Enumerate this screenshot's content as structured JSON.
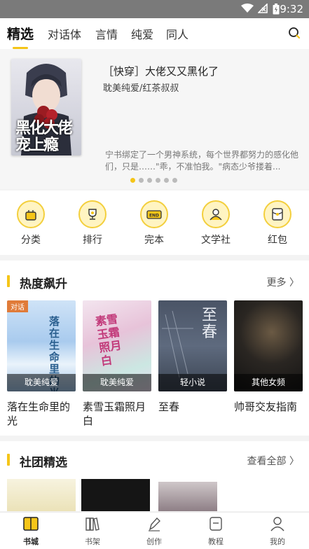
{
  "status": {
    "time": "9:32"
  },
  "tabs": [
    "精选",
    "对话体",
    "言情",
    "纯爱",
    "同人"
  ],
  "banner": {
    "title": "［快穿］大佬又又黑化了",
    "subtitle": "耽美纯爱/红茶叔叔",
    "description": "宁书绑定了一个男神系统，每个世界都努力的感化他们，只是……\"乖，不准怕我。\"病态少爷搂着...",
    "cover_text": "黑化大佬宠上瘾",
    "slide_count": 6,
    "active_slide": 0
  },
  "categories": [
    {
      "label": "分类",
      "icon": "shopping-bag-icon"
    },
    {
      "label": "排行",
      "icon": "trophy-icon"
    },
    {
      "label": "完本",
      "icon": "end-tag-icon"
    },
    {
      "label": "文学社",
      "icon": "people-icon"
    },
    {
      "label": "红包",
      "icon": "red-envelope-icon"
    }
  ],
  "hot_section": {
    "title": "热度飙升",
    "more": "更多",
    "books": [
      {
        "title": "落在生命里的光",
        "category": "耽美纯爱",
        "tag": "对话",
        "cover_text": "落在生命里的光"
      },
      {
        "title": "素雪玉霜照月白",
        "category": "耽美纯爱",
        "tag": "",
        "cover_text": "素雪玉霜照月白"
      },
      {
        "title": "至春",
        "category": "轻小说",
        "tag": "",
        "cover_text": "至春"
      },
      {
        "title": "帅哥交友指南",
        "category": "其他女频",
        "tag": "",
        "cover_text": ""
      }
    ]
  },
  "club_section": {
    "title": "社团精选",
    "more": "查看全部"
  },
  "bottom_nav": [
    {
      "label": "书城",
      "icon": "book-open-icon",
      "active": true
    },
    {
      "label": "书架",
      "icon": "bookshelf-icon",
      "active": false
    },
    {
      "label": "创作",
      "icon": "pen-icon",
      "active": false
    },
    {
      "label": "教程",
      "icon": "tutorial-icon",
      "active": false
    },
    {
      "label": "我的",
      "icon": "person-icon",
      "active": false
    }
  ],
  "colors": {
    "accent": "#f5c518",
    "status_bar": "#7a7a7a"
  }
}
